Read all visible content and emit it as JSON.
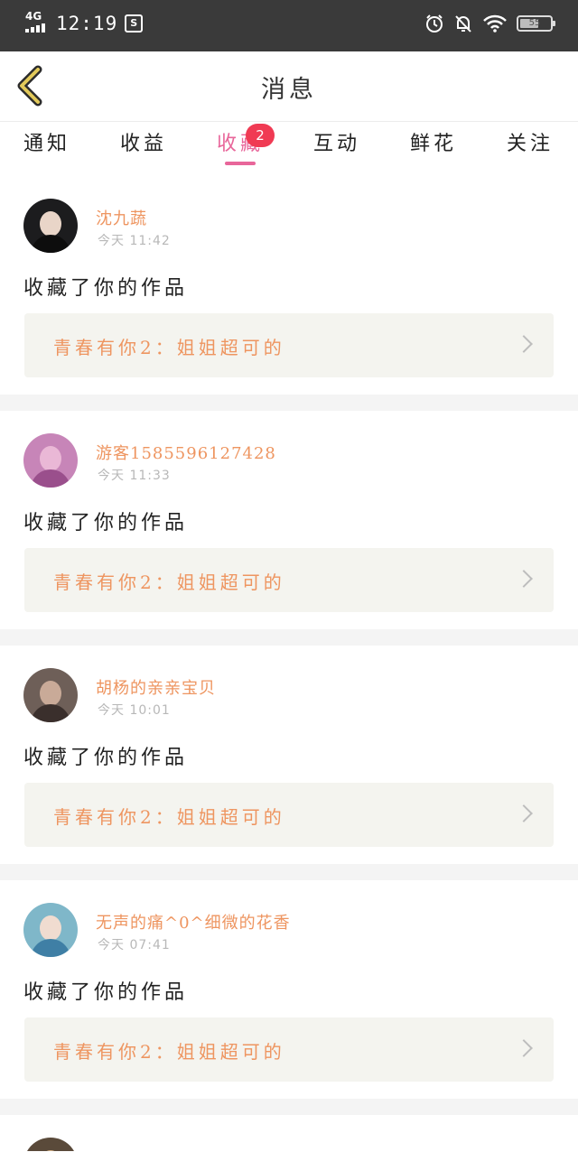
{
  "status_bar": {
    "network": "4G",
    "time": "12:19",
    "s_badge": "S",
    "battery": "55",
    "battery_level": 0.55
  },
  "header": {
    "title": "消息"
  },
  "tabs": [
    {
      "label": "通知"
    },
    {
      "label": "收益"
    },
    {
      "label": "收藏",
      "active": true,
      "badge": "2"
    },
    {
      "label": "互动"
    },
    {
      "label": "鲜花"
    },
    {
      "label": "关注"
    }
  ],
  "messages": [
    {
      "user": "沈九蔬",
      "time": "今天 11:42",
      "action": "收藏了你的作品",
      "work": "青春有你2：姐姐超可的"
    },
    {
      "user": "游客1585596127428",
      "time": "今天 11:33",
      "action": "收藏了你的作品",
      "work": "青春有你2：姐姐超可的"
    },
    {
      "user": "胡杨的亲亲宝贝",
      "time": "今天 10:01",
      "action": "收藏了你的作品",
      "work": "青春有你2：姐姐超可的"
    },
    {
      "user": "无声的痛^0^细微的花香",
      "time": "今天 07:41",
      "action": "收藏了你的作品",
      "work": "青春有你2：姐姐超可的"
    }
  ],
  "colors": {
    "accent": "#e8669a",
    "username": "#ee9560",
    "badge": "#f03a53"
  }
}
